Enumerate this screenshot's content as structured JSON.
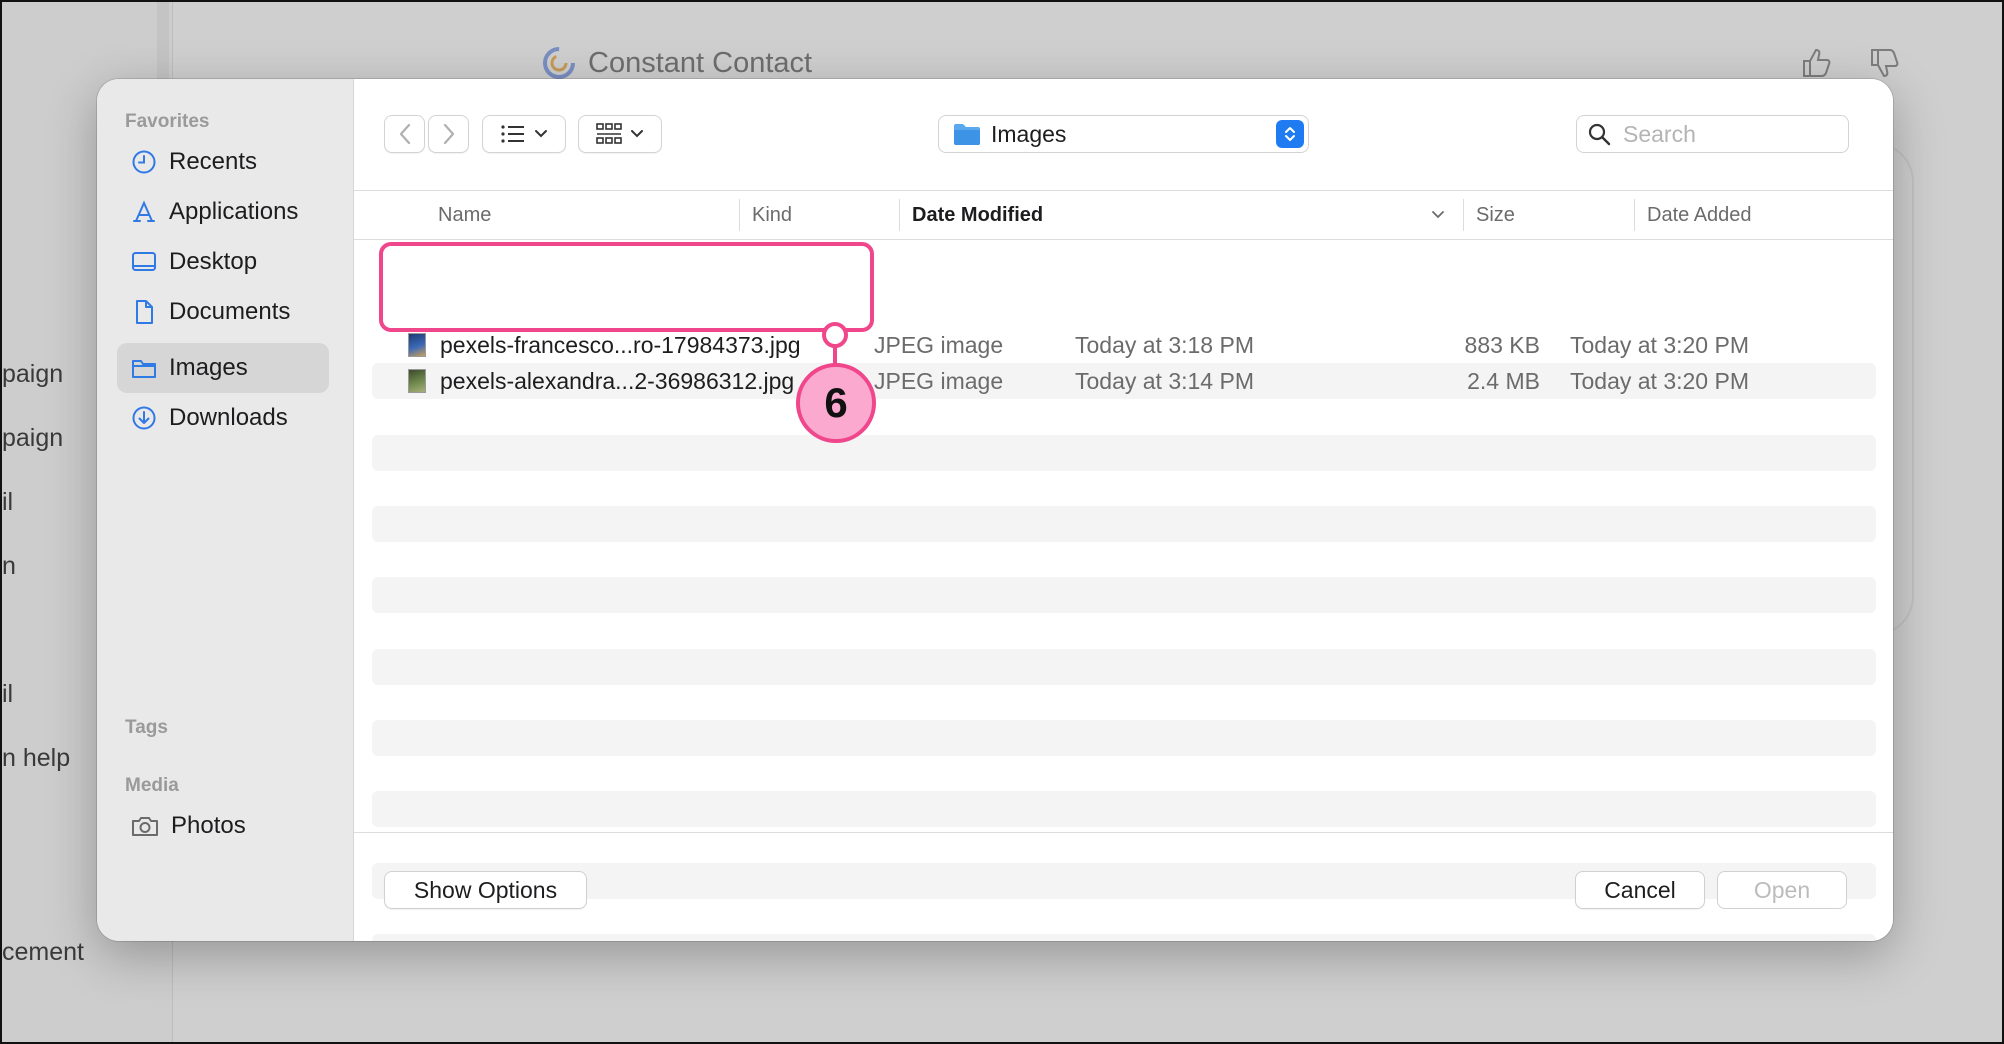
{
  "background": {
    "app_name": "Constant Contact",
    "left_nav_fragments": [
      "paign",
      "paign",
      "il",
      "n",
      "il",
      "n help",
      "cement"
    ]
  },
  "sidebar": {
    "favorites_label": "Favorites",
    "favorites": [
      {
        "label": "Recents",
        "icon": "clock-icon"
      },
      {
        "label": "Applications",
        "icon": "applications-icon"
      },
      {
        "label": "Desktop",
        "icon": "desktop-icon"
      },
      {
        "label": "Documents",
        "icon": "document-icon"
      },
      {
        "label": "Images",
        "icon": "folder-icon",
        "selected": true
      },
      {
        "label": "Downloads",
        "icon": "download-icon"
      }
    ],
    "tags_label": "Tags",
    "media_label": "Media",
    "media": [
      {
        "label": "Photos",
        "icon": "camera-icon"
      }
    ]
  },
  "toolbar": {
    "current_folder": "Images",
    "search_placeholder": "Search"
  },
  "columns": {
    "name": "Name",
    "kind": "Kind",
    "date_modified": "Date Modified",
    "size": "Size",
    "date_added": "Date Added"
  },
  "files": [
    {
      "name": "pexels-francesco...ro-17984373.jpg",
      "kind": "JPEG image",
      "date_modified": "Today at 3:18 PM",
      "size": "883 KB",
      "date_added": "Today at 3:20 PM"
    },
    {
      "name": "pexels-alexandra...2-36986312.jpg",
      "kind": "JPEG image",
      "date_modified": "Today at 3:14 PM",
      "size": "2.4 MB",
      "date_added": "Today at 3:20 PM"
    }
  ],
  "footer": {
    "show_options": "Show Options",
    "cancel": "Cancel",
    "open": "Open"
  },
  "annotation": {
    "step_number": "6",
    "color": "#f0468b"
  }
}
